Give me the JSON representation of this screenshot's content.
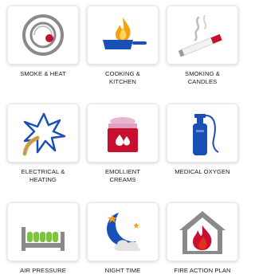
{
  "tiles": [
    {
      "label": "SMOKE & HEAT",
      "icon": "smoke-detector-icon"
    },
    {
      "label": "COOKING &\nKITCHEN",
      "icon": "frying-pan-flame-icon"
    },
    {
      "label": "SMOKING &\nCANDLES",
      "icon": "cigarette-icon"
    },
    {
      "label": "ELECTRICAL &\nHEATING",
      "icon": "electric-plug-spark-icon"
    },
    {
      "label": "EMOLLIENT\nCREAMS",
      "icon": "cream-jar-icon"
    },
    {
      "label": "MEDICAL OXYGEN",
      "icon": "oxygen-cylinder-icon"
    },
    {
      "label": "AIR PRESSURE",
      "icon": "air-mattress-bed-icon"
    },
    {
      "label": "NIGHT TIME",
      "icon": "moon-stars-icon"
    },
    {
      "label": "FIRE ACTION PLAN",
      "icon": "house-fire-icon"
    }
  ],
  "colors": {
    "card_border": "#e8e8e8",
    "label_text": "#1a1a1a",
    "red": "#c8102e",
    "blue": "#1a4fb8",
    "orange": "#f5a00d",
    "green": "#7dc242",
    "pink": "#e8b7cf",
    "gray": "#8a8a8a"
  }
}
